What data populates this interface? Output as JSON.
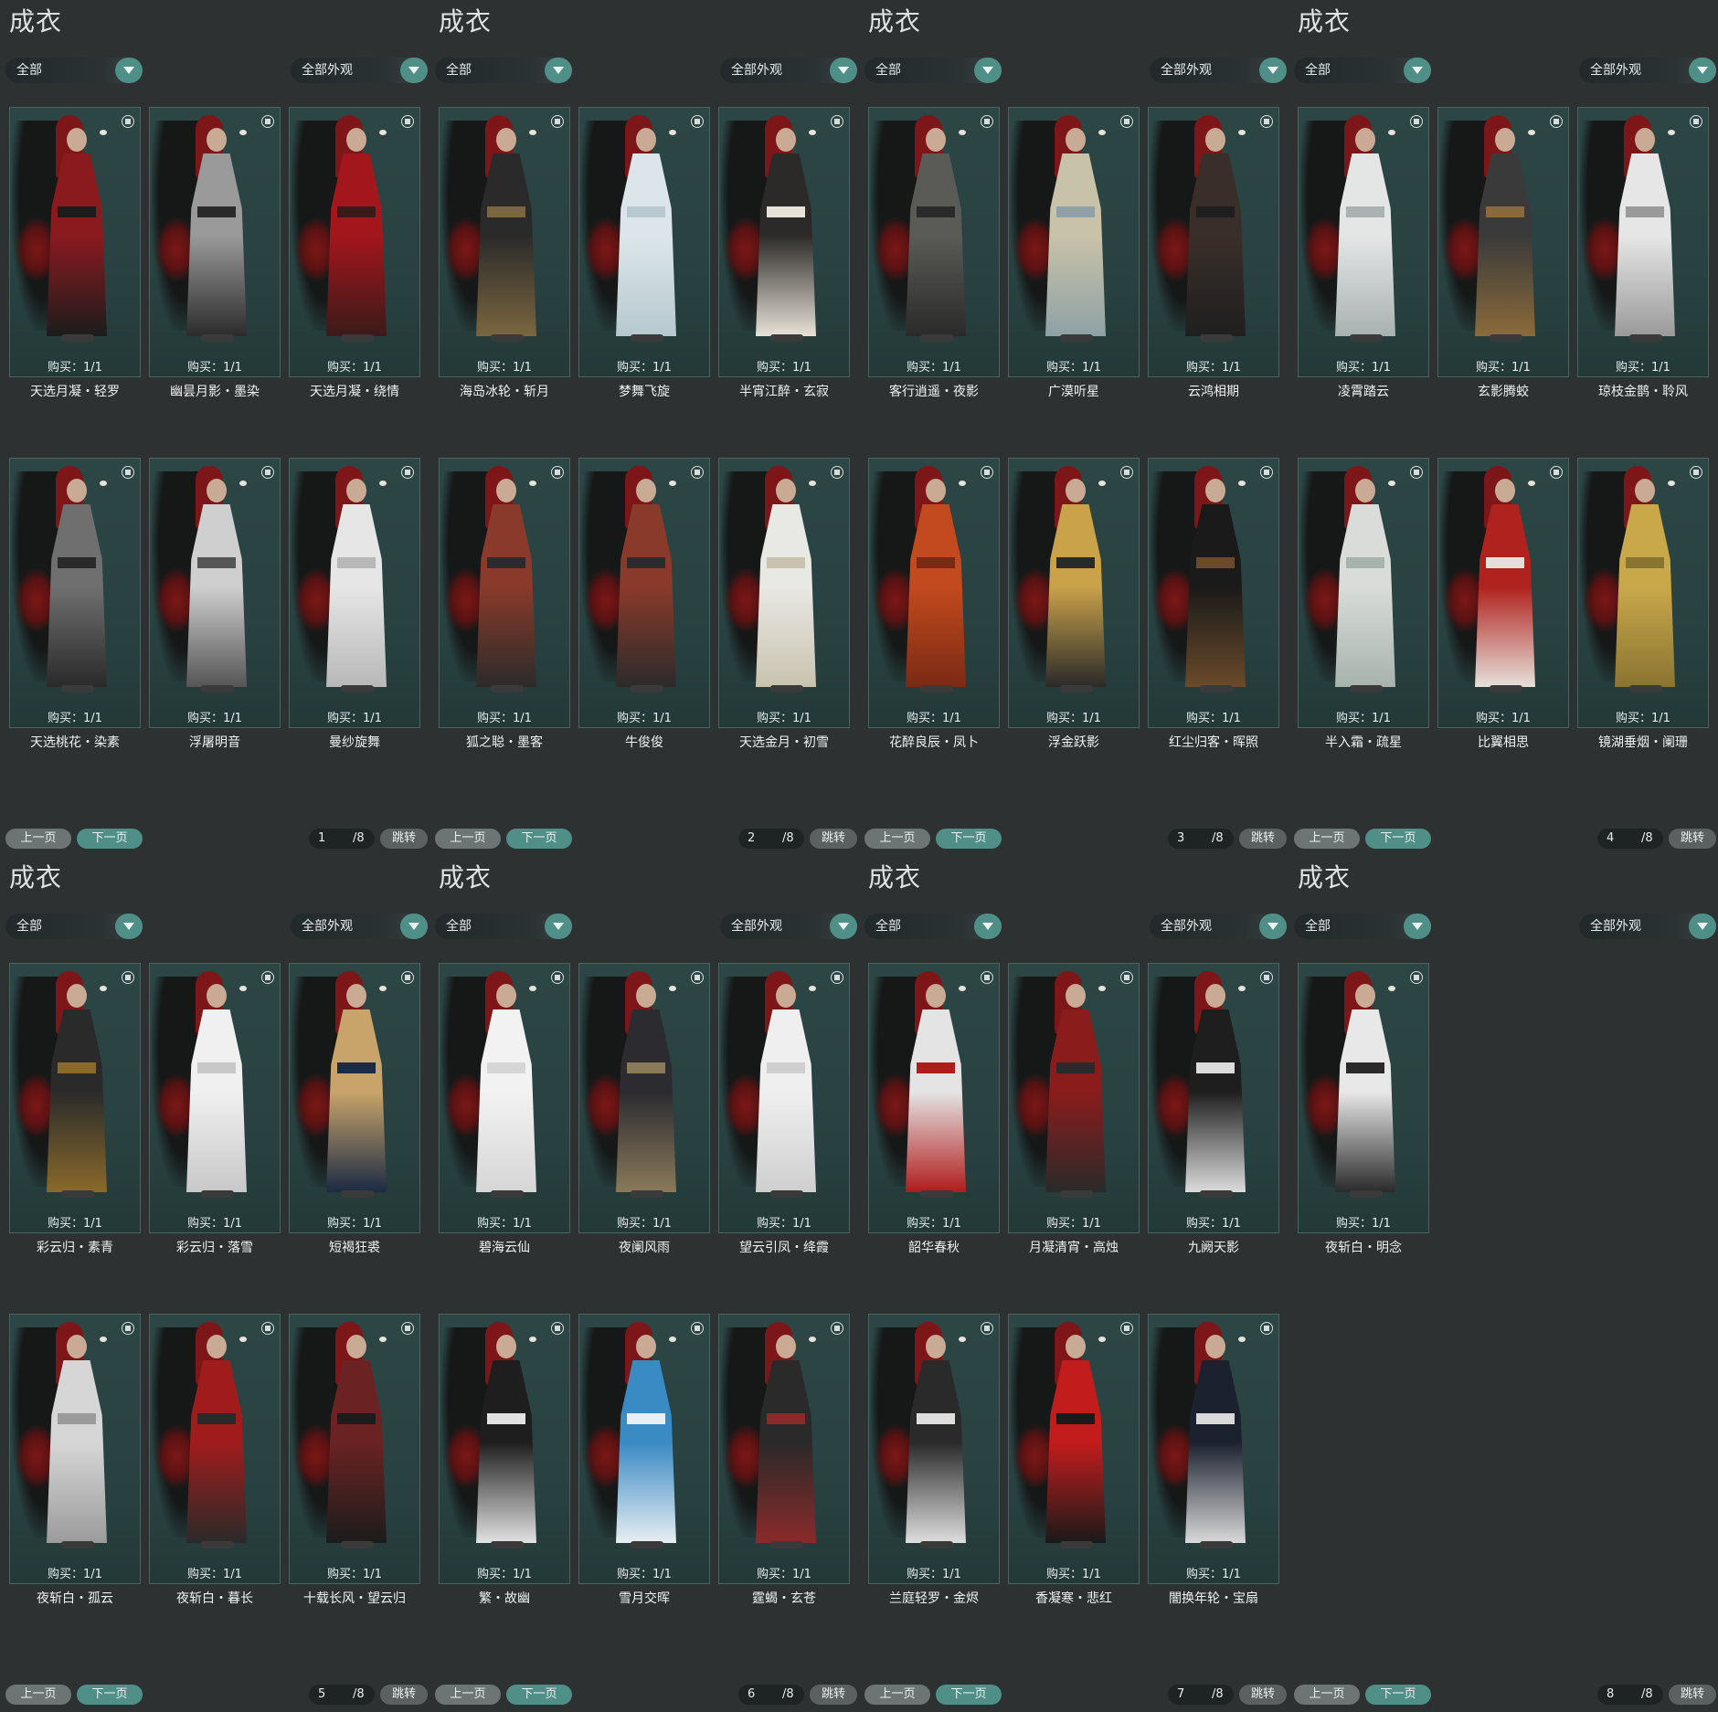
{
  "title": "成衣",
  "filter_label": "全部",
  "appearance_label": "全部外观",
  "buy_label": "购买：1/1",
  "prev_label": "上一页",
  "next_label": "下一页",
  "jump_label": "跳转",
  "total_pages": "/8",
  "panels": [
    {
      "page": "1",
      "items": [
        "天选月凝・轻罗",
        "幽昙月影・墨染",
        "天选月凝・绕情",
        "天选桃花・染素",
        "浮屠明音",
        "曼纱旋舞"
      ]
    },
    {
      "page": "2",
      "items": [
        "海岛冰轮・斩月",
        "梦舞飞旋",
        "半宵江醉・玄寂",
        "狐之聪・墨客",
        "牛俊俊",
        "天选金月・初雪"
      ]
    },
    {
      "page": "3",
      "items": [
        "客行逍遥・夜影",
        "广漠听星",
        "云鸿相期",
        "花醉良辰・凤卜",
        "浮金跃影",
        "红尘归客・晖照"
      ]
    },
    {
      "page": "4",
      "items": [
        "凌霄踏云",
        "玄影腾蛟",
        "琼枝金鹊・聆风",
        "半入霜・疏星",
        "比翼相思",
        "镜湖垂烟・阑珊"
      ]
    },
    {
      "page": "5",
      "items": [
        "彩云归・素青",
        "彩云归・落雪",
        "短褐狂裘",
        "夜斩白・孤云",
        "夜斩白・暮长",
        "十载长风・望云归"
      ]
    },
    {
      "page": "6",
      "items": [
        "碧海云仙",
        "夜阑风雨",
        "望云引凤・绛霞",
        "繁・故幽",
        "雪月交晖",
        "霆蝎・玄苍"
      ]
    },
    {
      "page": "7",
      "items": [
        "韶华春秋",
        "月凝清宵・高烛",
        "九阙天影",
        "兰庭轻罗・金烬",
        "香凝寒・悲红",
        "闇换年轮・宝扇"
      ]
    },
    {
      "page": "8",
      "items": [
        "夜斩白・明念"
      ]
    }
  ],
  "outfit_colors": [
    [
      "#8a1a1e",
      "#1c1c1c"
    ],
    [
      "#9a9a9a",
      "#2b2b2b"
    ],
    [
      "#a3161c",
      "#3a1a1a"
    ],
    [
      "#6f6f6f",
      "#2a2a2a"
    ],
    [
      "#cfcfcf",
      "#555555"
    ],
    [
      "#e6e6e6",
      "#b8b8b8"
    ],
    [
      "#2a2a2a",
      "#7a6640"
    ],
    [
      "#dce6ea",
      "#b7c9cf"
    ],
    [
      "#2c2a28",
      "#e8e2d8"
    ],
    [
      "#8a3a2a",
      "#2b2b2b"
    ],
    [
      "#8a3a2a",
      "#2b2b2b"
    ],
    [
      "#e8e8e4",
      "#c9c2ae"
    ],
    [
      "#5a5a56",
      "#2a2a2a"
    ],
    [
      "#c8c2a8",
      "#8fa1a6"
    ],
    [
      "#3a2e2a",
      "#1f1f1f"
    ],
    [
      "#c24a1e",
      "#7a2a14"
    ],
    [
      "#c9a24a",
      "#2a2a2a"
    ],
    [
      "#1a1a1a",
      "#6a4a2a"
    ],
    [
      "#e4e6e6",
      "#a9b1b1"
    ],
    [
      "#3a3a3a",
      "#8a6a3a"
    ],
    [
      "#e6e6e6",
      "#9a9a9a"
    ],
    [
      "#d9dcd8",
      "#a7b3ad"
    ],
    [
      "#b0221e",
      "#e6e0da"
    ],
    [
      "#c9a84a",
      "#8a7432"
    ],
    [
      "#2a2a2a",
      "#8a6a2a"
    ],
    [
      "#f0f0f0",
      "#c8c8c8"
    ],
    [
      "#c8a46a",
      "#1c2a44"
    ],
    [
      "#d6d6d6",
      "#9b9b9b"
    ],
    [
      "#a01c1c",
      "#2a2a2a"
    ],
    [
      "#6a2222",
      "#1c1c1c"
    ],
    [
      "#f2f2f2",
      "#d6d6d6"
    ],
    [
      "#2b2b30",
      "#8a7a5a"
    ],
    [
      "#efefef",
      "#cfcfcf"
    ],
    [
      "#1e1e1e",
      "#e2e2e2"
    ],
    [
      "#3a8ac4",
      "#e8eef2"
    ],
    [
      "#2a2a2a",
      "#8a2a2a"
    ],
    [
      "#e4e4e4",
      "#b01c1c"
    ],
    [
      "#8a1c1c",
      "#2a2a2a"
    ],
    [
      "#1e1e1e",
      "#dcdcdc"
    ],
    [
      "#2a2a2a",
      "#dedede"
    ],
    [
      "#c21c1c",
      "#1a1a1a"
    ],
    [
      "#1c2130",
      "#d9d9d9"
    ],
    [
      "#e8e8e8",
      "#2a2a2a"
    ]
  ]
}
